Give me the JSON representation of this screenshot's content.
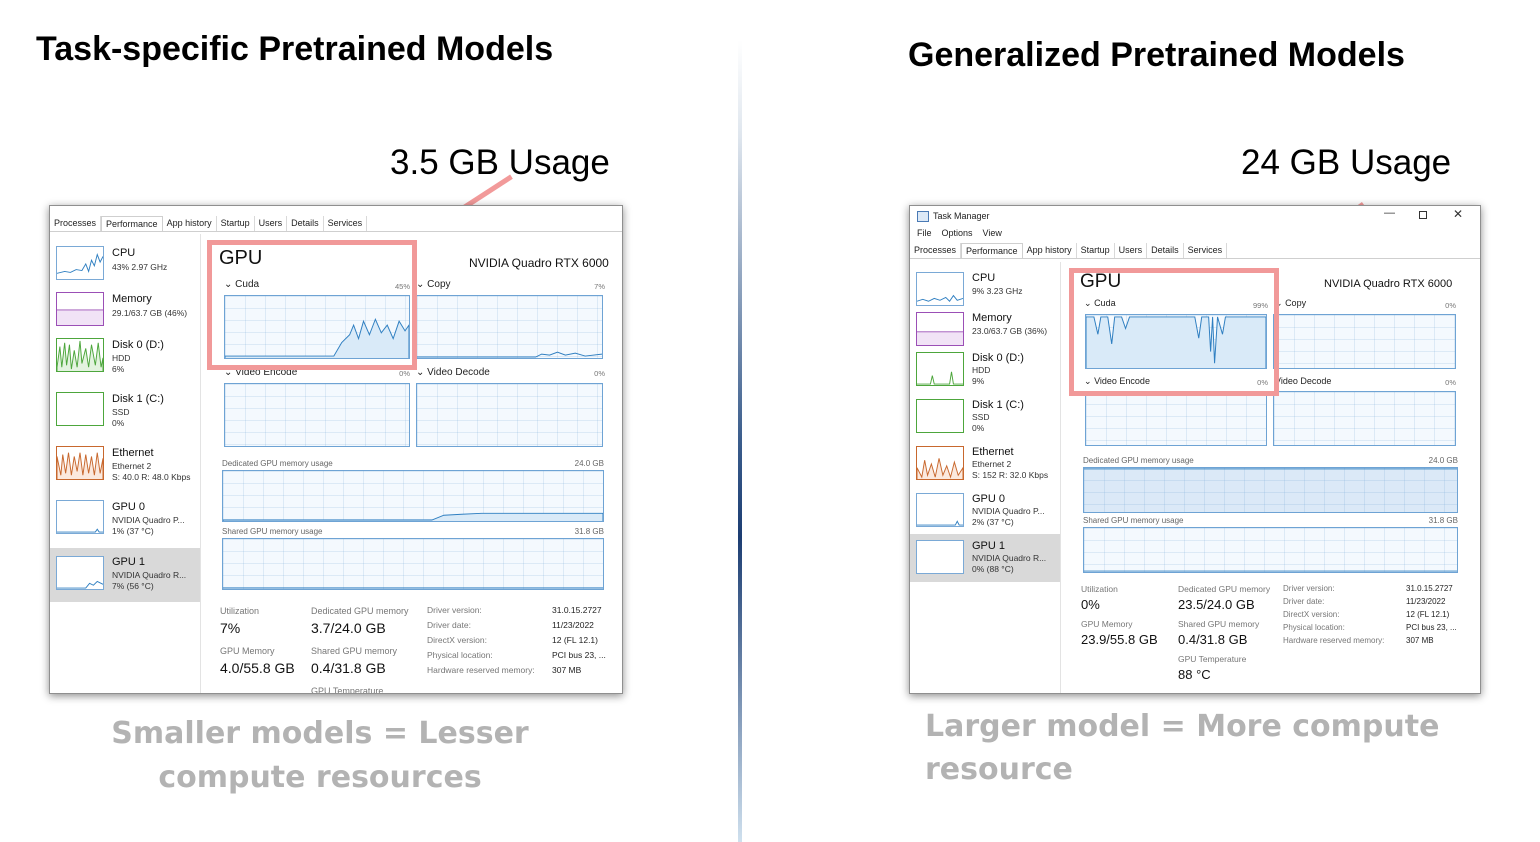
{
  "left": {
    "title": "Task-specific Pretrained Models",
    "usage_label": "3.5 GB Usage",
    "caption": "Smaller models = Lesser compute resources",
    "tm": {
      "tabs": [
        "Processes",
        "Performance",
        "App history",
        "Startup",
        "Users",
        "Details",
        "Services"
      ],
      "sidebar": [
        {
          "name": "CPU",
          "lines": [
            "43% 2.97 GHz"
          ]
        },
        {
          "name": "Memory",
          "lines": [
            "29.1/63.7 GB (46%)"
          ]
        },
        {
          "name": "Disk 0 (D:)",
          "lines": [
            "HDD",
            "6%"
          ]
        },
        {
          "name": "Disk 1 (C:)",
          "lines": [
            "SSD",
            "0%"
          ]
        },
        {
          "name": "Ethernet",
          "lines": [
            "Ethernet 2",
            "S: 40.0 R: 48.0 Kbps"
          ]
        },
        {
          "name": "GPU 0",
          "lines": [
            "NVIDIA Quadro P...",
            "1% (37 °C)"
          ]
        },
        {
          "name": "GPU 1",
          "lines": [
            "NVIDIA Quadro R...",
            "7% (56 °C)"
          ]
        }
      ],
      "gpu_heading": "GPU",
      "gpu_model": "NVIDIA Quadro RTX 6000",
      "graphs": {
        "cuda": {
          "label": "Cuda",
          "pct": "45%"
        },
        "copy": {
          "label": "Copy",
          "pct": "7%"
        },
        "video_encode": {
          "label": "Video Encode",
          "pct": "0%"
        },
        "video_decode": {
          "label": "Video Decode",
          "pct": "0%"
        }
      },
      "dedicated_label": "Dedicated GPU memory usage",
      "dedicated_max": "24.0 GB",
      "shared_label": "Shared GPU memory usage",
      "shared_max": "31.8 GB",
      "stats": {
        "utilization_label": "Utilization",
        "utilization": "7%",
        "dedicated_mem_label": "Dedicated GPU memory",
        "dedicated_mem": "3.7/24.0 GB",
        "gpu_memory_label": "GPU Memory",
        "gpu_memory": "4.0/55.8 GB",
        "shared_mem_label": "Shared GPU memory",
        "shared_mem": "0.4/31.8 GB",
        "gpu_temp_label": "GPU Temperature"
      },
      "driver": {
        "labels": [
          "Driver version:",
          "Driver date:",
          "DirectX version:",
          "Physical location:",
          "Hardware reserved memory:"
        ],
        "values": [
          "31.0.15.2727",
          "11/23/2022",
          "12 (FL 12.1)",
          "PCI bus 23, ...",
          "307 MB"
        ]
      }
    }
  },
  "right": {
    "title": "Generalized Pretrained Models",
    "usage_label": "24 GB Usage",
    "caption_line1": "Larger model = More compute",
    "caption_line2": "resource",
    "tm": {
      "window_title": "Task Manager",
      "menu": [
        "File",
        "Options",
        "View"
      ],
      "tabs": [
        "Processes",
        "Performance",
        "App history",
        "Startup",
        "Users",
        "Details",
        "Services"
      ],
      "sidebar": [
        {
          "name": "CPU",
          "lines": [
            "9% 3.23 GHz"
          ]
        },
        {
          "name": "Memory",
          "lines": [
            "23.0/63.7 GB (36%)"
          ]
        },
        {
          "name": "Disk 0 (D:)",
          "lines": [
            "HDD",
            "9%"
          ]
        },
        {
          "name": "Disk 1 (C:)",
          "lines": [
            "SSD",
            "0%"
          ]
        },
        {
          "name": "Ethernet",
          "lines": [
            "Ethernet 2",
            "S: 152 R: 32.0 Kbps"
          ]
        },
        {
          "name": "GPU 0",
          "lines": [
            "NVIDIA Quadro P...",
            "2% (37 °C)"
          ]
        },
        {
          "name": "GPU 1",
          "lines": [
            "NVIDIA Quadro R...",
            "0% (88 °C)"
          ]
        }
      ],
      "gpu_heading": "GPU",
      "gpu_model": "NVIDIA Quadro RTX 6000",
      "graphs": {
        "cuda": {
          "label": "Cuda",
          "pct": "99%"
        },
        "copy": {
          "label": "Copy",
          "pct": "0%"
        },
        "video_encode": {
          "label": "Video Encode",
          "pct": "0%"
        },
        "video_decode": {
          "label": "Video Decode",
          "pct": "0%"
        }
      },
      "dedicated_label": "Dedicated GPU memory usage",
      "dedicated_max": "24.0 GB",
      "shared_label": "Shared GPU memory usage",
      "shared_max": "31.8 GB",
      "stats": {
        "utilization_label": "Utilization",
        "utilization": "0%",
        "dedicated_mem_label": "Dedicated GPU memory",
        "dedicated_mem": "23.5/24.0 GB",
        "gpu_memory_label": "GPU Memory",
        "gpu_memory": "23.9/55.8 GB",
        "shared_mem_label": "Shared GPU memory",
        "shared_mem": "0.4/31.8 GB",
        "gpu_temp_label": "GPU Temperature",
        "gpu_temp": "88 °C"
      },
      "driver": {
        "labels": [
          "Driver version:",
          "Driver date:",
          "DirectX version:",
          "Physical location:",
          "Hardware reserved memory:"
        ],
        "values": [
          "31.0.15.2727",
          "11/23/2022",
          "12 (FL 12.1)",
          "PCI bus 23, ...",
          "307 MB"
        ]
      }
    }
  },
  "icons": {
    "task-manager-icon": "task-manager",
    "minimize-icon": "minimize",
    "maximize-icon": "maximize",
    "close-icon": "close"
  }
}
